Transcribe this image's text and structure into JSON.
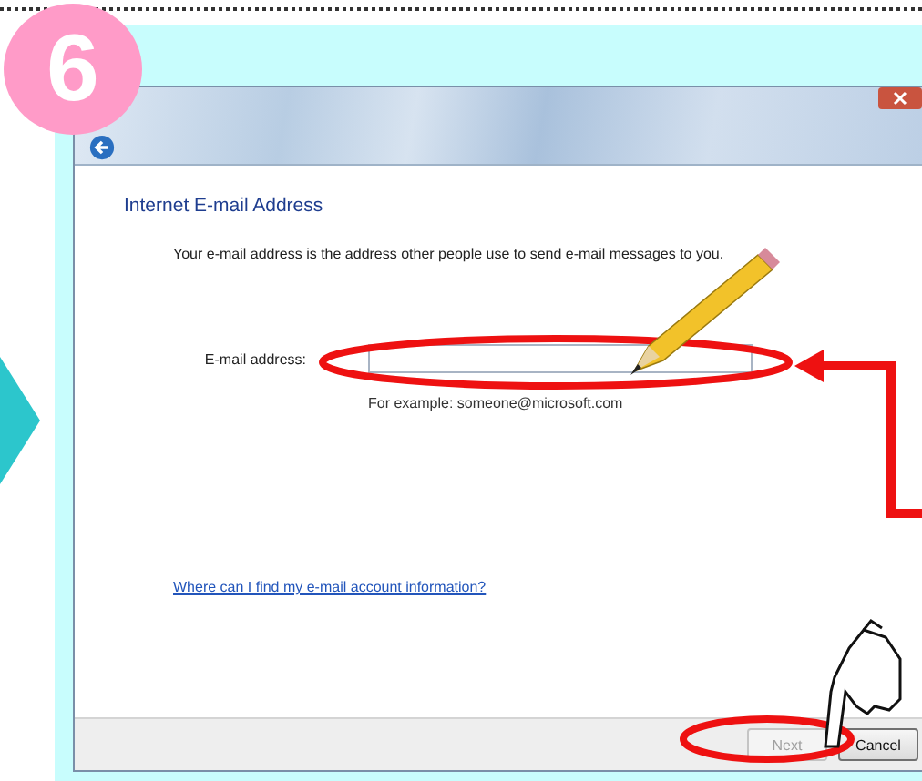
{
  "step_badge": "6",
  "dialog": {
    "heading": "Internet E-mail Address",
    "description": "Your e-mail address is the address other people use to send e-mail messages to you.",
    "email_field": {
      "label": "E-mail address:",
      "hint": "For example: someone@microsoft.com"
    },
    "help_link": "Where can I find my e-mail account information?",
    "buttons": [
      {
        "label": "Next",
        "disabled": true
      },
      {
        "label": "Cancel",
        "disabled": false
      }
    ]
  }
}
